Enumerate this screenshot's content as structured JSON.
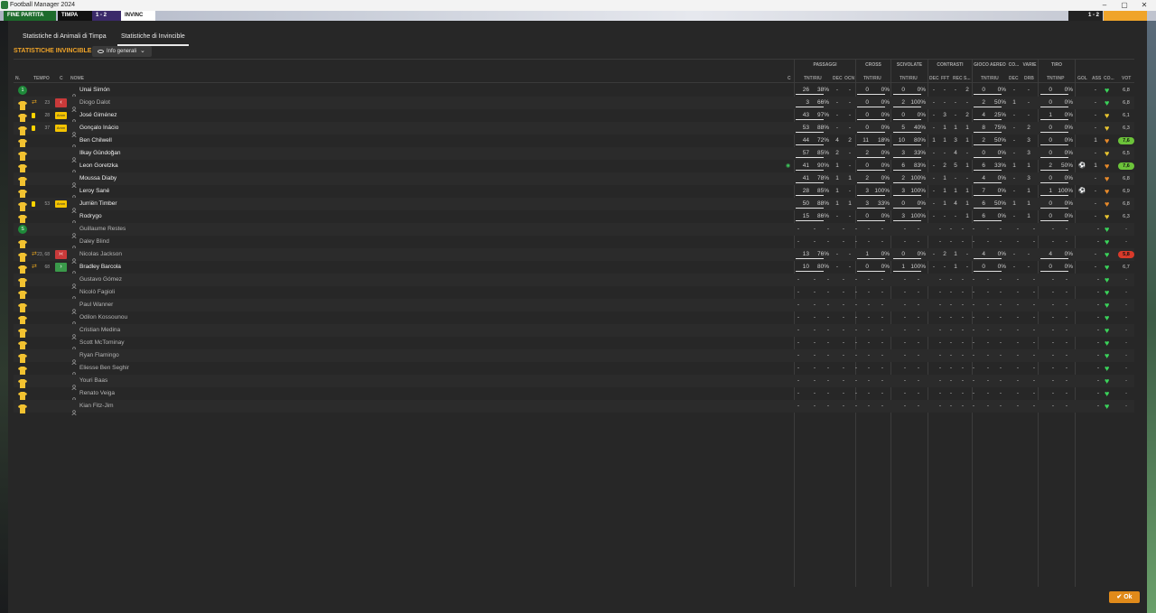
{
  "window": {
    "title": "Football Manager 2024"
  },
  "match_bar": {
    "status": "FINE PARTITA",
    "home": "TIMPA",
    "score": "1 - 2",
    "away": "INVINC"
  },
  "tabs": [
    {
      "label": "Statistiche di Animali di Timpa",
      "active": false
    },
    {
      "label": "Statistiche di Invincible",
      "active": true
    }
  ],
  "section_title": "STATISTICHE INVINCIBLE",
  "view_dropdown": {
    "label": "Info generali"
  },
  "columns": {
    "num": "N.",
    "time": "TEMPO",
    "c": "C",
    "name": "NOME",
    "c2": "C",
    "groups": {
      "passes": "PASSAGGI",
      "cross": "CROSS",
      "slides": "SCIVOLATE",
      "tackles": "CONTRASTI",
      "aerial": "GIOCO AEREO",
      "co": "CO...",
      "misc": "VARIE",
      "shots": "TIRO"
    },
    "sub": {
      "pass_tnt": "TNT/RIU",
      "dec": "DEC",
      "ocn": "OCN",
      "cross_tnt": "TNT/RIU",
      "slide_tnt": "TNT/RIU",
      "t_dec": "DEC",
      "fft": "FFT",
      "rec": "REC",
      "s": "S...",
      "air_tnt": "TNT/RIU",
      "co_dec": "DEC",
      "drb": "DRB",
      "shot_tnt": "TNT/INP",
      "gol": "GOL",
      "ass": "ASS",
      "cond": "CO...",
      "vot": "VOT"
    }
  },
  "players": [
    {
      "pos": "1",
      "time": "",
      "card": "",
      "amm": "",
      "name": "Unai Simón",
      "starter": true,
      "pass": [
        "26",
        "38%"
      ],
      "dec": "-",
      "ocn": "-",
      "cross": [
        "0",
        "0%"
      ],
      "slide": [
        "0",
        "0%"
      ],
      "tdec": "-",
      "fft": "-",
      "rec": "-",
      "s": "2",
      "air": [
        "0",
        "0%"
      ],
      "codec": "-",
      "drb": "-",
      "shot": [
        "0",
        "0%"
      ],
      "gol": "",
      "ass": "-",
      "cond": "green",
      "vot": "6,8"
    },
    {
      "pos": "",
      "time": "23",
      "card": "",
      "subout": true,
      "redbox": "‹",
      "name": "Diogo Dalot",
      "starter": false,
      "pass": [
        "3",
        "66%"
      ],
      "dec": "-",
      "ocn": "-",
      "cross": [
        "0",
        "0%"
      ],
      "slide": [
        "2",
        "100%"
      ],
      "tdec": "-",
      "fft": "-",
      "rec": "-",
      "s": "-",
      "air": [
        "2",
        "50%"
      ],
      "codec": "1",
      "drb": "-",
      "shot": [
        "0",
        "0%"
      ],
      "gol": "",
      "ass": "-",
      "cond": "green",
      "vot": "6,8"
    },
    {
      "pos": "",
      "time": "28",
      "card": "yellow",
      "amm": "Amm",
      "name": "José Giménez",
      "starter": true,
      "pass": [
        "43",
        "97%"
      ],
      "dec": "-",
      "ocn": "-",
      "cross": [
        "0",
        "0%"
      ],
      "slide": [
        "0",
        "0%"
      ],
      "tdec": "-",
      "fft": "3",
      "rec": "-",
      "s": "2",
      "air": [
        "4",
        "25%"
      ],
      "codec": "-",
      "drb": "-",
      "shot": [
        "1",
        "0%"
      ],
      "gol": "",
      "ass": "-",
      "cond": "yellow",
      "vot": "6,1"
    },
    {
      "pos": "",
      "time": "37",
      "card": "yellow",
      "amm": "Amm",
      "name": "Gonçalo Inácio",
      "starter": true,
      "pass": [
        "53",
        "88%"
      ],
      "dec": "-",
      "ocn": "-",
      "cross": [
        "0",
        "0%"
      ],
      "slide": [
        "5",
        "40%"
      ],
      "tdec": "-",
      "fft": "1",
      "rec": "1",
      "s": "1",
      "air": [
        "8",
        "75%"
      ],
      "codec": "-",
      "drb": "2",
      "shot": [
        "0",
        "0%"
      ],
      "gol": "",
      "ass": "-",
      "cond": "yellow",
      "vot": "6,3"
    },
    {
      "pos": "",
      "time": "",
      "card": "",
      "name": "Ben Chilwell",
      "starter": true,
      "pass": [
        "44",
        "72%"
      ],
      "dec": "4",
      "ocn": "2",
      "cross": [
        "11",
        "18%"
      ],
      "slide": [
        "10",
        "80%"
      ],
      "tdec": "1",
      "fft": "1",
      "rec": "3",
      "s": "1",
      "air": [
        "2",
        "50%"
      ],
      "codec": "-",
      "drb": "3",
      "shot": [
        "0",
        "0%"
      ],
      "gol": "",
      "ass": "1",
      "cond": "orange",
      "vot": "7,6",
      "vot_color": "#6cc33a"
    },
    {
      "pos": "",
      "time": "",
      "card": "",
      "name": "Ilkay Gündoğan",
      "starter": true,
      "pass": [
        "57",
        "85%"
      ],
      "dec": "2",
      "ocn": "-",
      "cross": [
        "2",
        "0%"
      ],
      "slide": [
        "3",
        "33%"
      ],
      "tdec": "-",
      "fft": "-",
      "rec": "4",
      "s": "-",
      "air": [
        "0",
        "0%"
      ],
      "codec": "-",
      "drb": "3",
      "shot": [
        "0",
        "0%"
      ],
      "gol": "",
      "ass": "-",
      "cond": "yellow",
      "vot": "6,5"
    },
    {
      "pos": "",
      "time": "",
      "card": "",
      "name": "Leon Goretzka",
      "starter": true,
      "ball_mark": true,
      "pass": [
        "41",
        "90%"
      ],
      "dec": "1",
      "ocn": "-",
      "cross": [
        "0",
        "0%"
      ],
      "slide": [
        "6",
        "83%"
      ],
      "tdec": "-",
      "fft": "2",
      "rec": "5",
      "s": "1",
      "air": [
        "6",
        "33%"
      ],
      "codec": "1",
      "drb": "1",
      "shot": [
        "2",
        "50%"
      ],
      "gol": "⚽",
      "ass": "1",
      "cond": "orange",
      "vot": "7,6",
      "vot_color": "#6cc33a"
    },
    {
      "pos": "",
      "time": "",
      "card": "",
      "name": "Moussa Diaby",
      "starter": true,
      "pass": [
        "41",
        "78%"
      ],
      "dec": "1",
      "ocn": "1",
      "cross": [
        "2",
        "0%"
      ],
      "slide": [
        "2",
        "100%"
      ],
      "tdec": "-",
      "fft": "1",
      "rec": "-",
      "s": "-",
      "air": [
        "4",
        "0%"
      ],
      "codec": "-",
      "drb": "3",
      "shot": [
        "0",
        "0%"
      ],
      "gol": "",
      "ass": "-",
      "cond": "orange",
      "vot": "6,8"
    },
    {
      "pos": "",
      "time": "",
      "card": "",
      "name": "Leroy Sané",
      "starter": true,
      "pass": [
        "28",
        "85%"
      ],
      "dec": "1",
      "ocn": "-",
      "cross": [
        "3",
        "100%"
      ],
      "slide": [
        "3",
        "100%"
      ],
      "tdec": "-",
      "fft": "1",
      "rec": "1",
      "s": "1",
      "air": [
        "7",
        "0%"
      ],
      "codec": "-",
      "drb": "1",
      "shot": [
        "1",
        "100%"
      ],
      "gol": "⚽",
      "ass": "-",
      "cond": "orange",
      "vot": "6,9"
    },
    {
      "pos": "",
      "time": "53",
      "card": "yellow",
      "amm": "Amm",
      "name": "Jurriën Timber",
      "starter": true,
      "pass": [
        "50",
        "88%"
      ],
      "dec": "1",
      "ocn": "1",
      "cross": [
        "3",
        "33%"
      ],
      "slide": [
        "0",
        "0%"
      ],
      "tdec": "-",
      "fft": "1",
      "rec": "4",
      "s": "1",
      "air": [
        "6",
        "50%"
      ],
      "codec": "1",
      "drb": "1",
      "shot": [
        "0",
        "0%"
      ],
      "gol": "",
      "ass": "-",
      "cond": "orange",
      "vot": "6,8"
    },
    {
      "pos": "",
      "time": "",
      "card": "",
      "name": "Rodrygo",
      "starter": true,
      "pass": [
        "15",
        "86%"
      ],
      "dec": "-",
      "ocn": "-",
      "cross": [
        "0",
        "0%"
      ],
      "slide": [
        "3",
        "100%"
      ],
      "tdec": "-",
      "fft": "-",
      "rec": "-",
      "s": "1",
      "air": [
        "6",
        "0%"
      ],
      "codec": "-",
      "drb": "1",
      "shot": [
        "0",
        "0%"
      ],
      "gol": "",
      "ass": "-",
      "cond": "yellow",
      "vot": "6,3"
    },
    {
      "pos": "S",
      "time": "",
      "card": "",
      "name": "Guillaume Restes",
      "starter": false,
      "empty": true,
      "cond": "green",
      "vot": "-"
    },
    {
      "pos": "",
      "time": "",
      "card": "",
      "name": "Daley Blind",
      "starter": false,
      "empty": true,
      "cond": "green",
      "vot": "-"
    },
    {
      "pos": "",
      "time": "23, 68",
      "card": "",
      "subin": true,
      "redbox": "›‹",
      "name": "Nicolas Jackson",
      "starter": false,
      "pass": [
        "13",
        "76%"
      ],
      "dec": "-",
      "ocn": "-",
      "cross": [
        "1",
        "0%"
      ],
      "slide": [
        "0",
        "0%"
      ],
      "tdec": "-",
      "fft": "2",
      "rec": "1",
      "s": "-",
      "air": [
        "4",
        "0%"
      ],
      "codec": "-",
      "drb": "-",
      "shot": [
        "4",
        "0%"
      ],
      "gol": "",
      "ass": "-",
      "cond": "green",
      "vot": "5,8",
      "vot_color": "#d83a2a"
    },
    {
      "pos": "",
      "time": "68",
      "card": "",
      "subin": true,
      "grnbox": "›",
      "name": "Bradley Barcola",
      "starter": true,
      "pass": [
        "10",
        "80%"
      ],
      "dec": "-",
      "ocn": "-",
      "cross": [
        "0",
        "0%"
      ],
      "slide": [
        "1",
        "100%"
      ],
      "tdec": "-",
      "fft": "-",
      "rec": "1",
      "s": "-",
      "air": [
        "0",
        "0%"
      ],
      "codec": "-",
      "drb": "-",
      "shot": [
        "0",
        "0%"
      ],
      "gol": "",
      "ass": "-",
      "cond": "green",
      "vot": "6,7"
    },
    {
      "name": "Gustavo Gómez",
      "empty": true,
      "cond": "green",
      "vot": "-"
    },
    {
      "name": "Nicolò Fagioli",
      "empty": true,
      "cond": "green",
      "vot": "-"
    },
    {
      "name": "Paul Wanner",
      "empty": true,
      "cond": "green",
      "vot": "-"
    },
    {
      "name": "Odilon Kossounou",
      "empty": true,
      "cond": "green",
      "vot": "-"
    },
    {
      "name": "Cristian Medina",
      "empty": true,
      "cond": "green",
      "vot": "-"
    },
    {
      "name": "Scott McTominay",
      "empty": true,
      "cond": "green",
      "vot": "-"
    },
    {
      "name": "Ryan Flamingo",
      "empty": true,
      "cond": "green",
      "vot": "-"
    },
    {
      "name": "Eliesse Ben Seghir",
      "empty": true,
      "cond": "green",
      "vot": "-"
    },
    {
      "name": "Youri Baas",
      "empty": true,
      "cond": "green",
      "vot": "-"
    },
    {
      "name": "Renato Veiga",
      "empty": true,
      "cond": "green",
      "vot": "-"
    },
    {
      "name": "Kian Fitz-Jim",
      "empty": true,
      "cond": "green",
      "vot": "-"
    }
  ],
  "ok_button": {
    "label": "Ok"
  },
  "colors": {
    "accent": "#f0a429",
    "shirt": "#f2c230",
    "gk": "#1f8a3a",
    "cond_green": "#3ad35a",
    "cond_yellow": "#e8c430",
    "cond_orange": "#e88a2a"
  }
}
